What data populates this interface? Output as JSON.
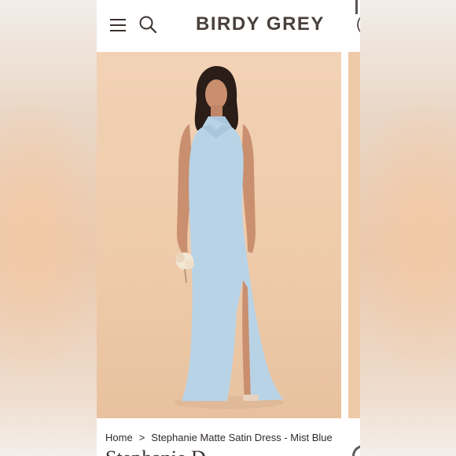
{
  "header": {
    "menu_icon": "hamburger-menu-icon",
    "search_icon": "search-icon",
    "brand": "BIRDY GREY",
    "next_brand_peek": "("
  },
  "product": {
    "image_alt": "Model wearing light blue halter satin maxi dress holding a small bouquet",
    "dress_color": "#b9d3e6",
    "background_color": "#efcbab"
  },
  "breadcrumb": {
    "home": "Home",
    "separator": ">",
    "current": "Stephanie Matte Satin Dress - Mist Blue"
  },
  "title_peek": "Stephanie D"
}
